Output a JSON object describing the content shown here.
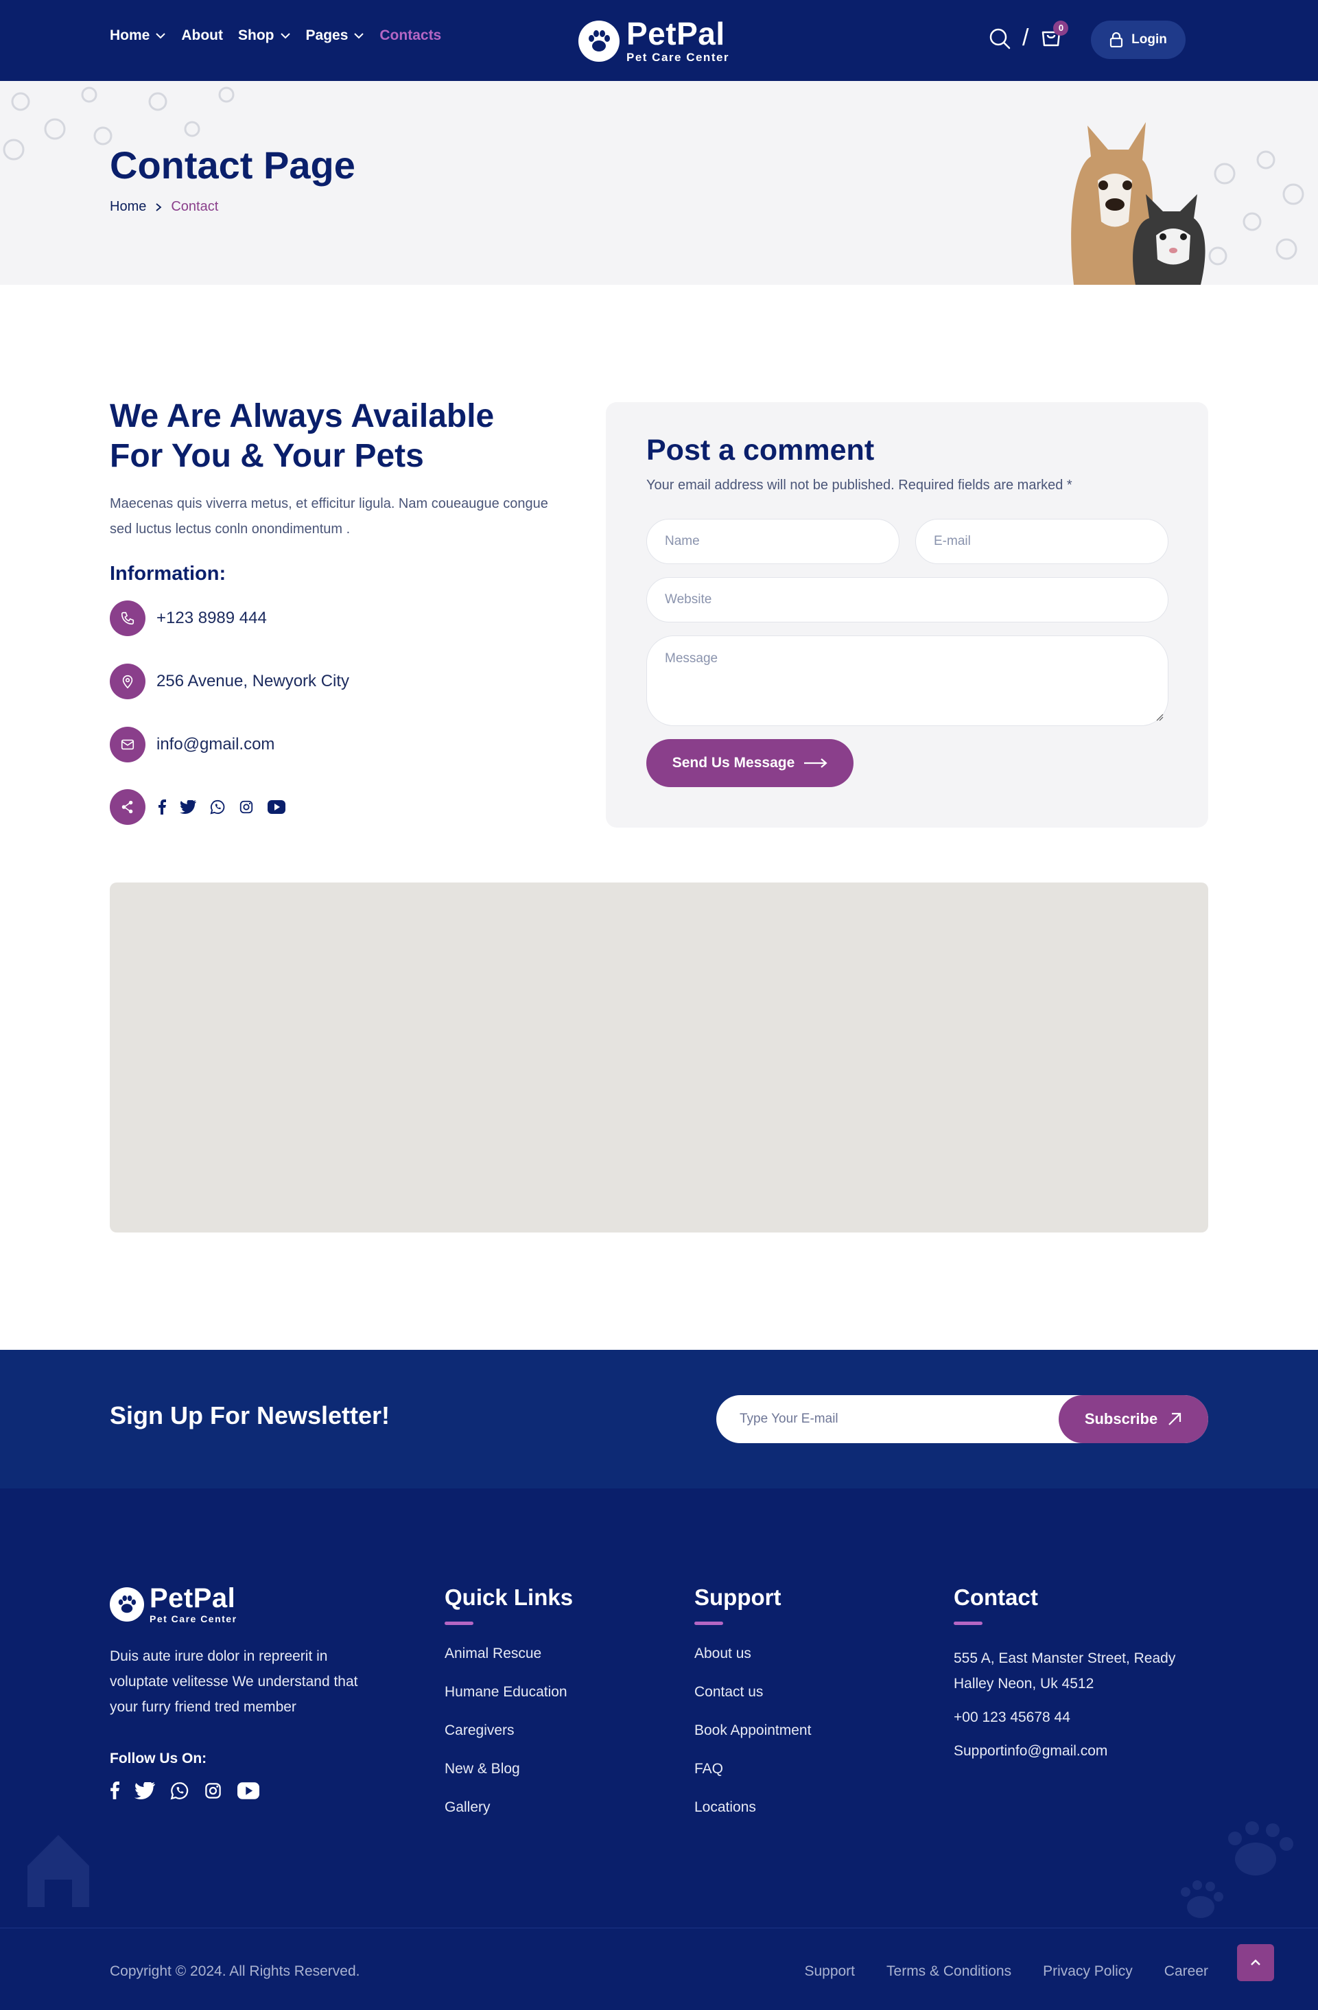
{
  "nav": {
    "items": [
      {
        "label": "Home",
        "has_dropdown": true,
        "active": false
      },
      {
        "label": "About",
        "has_dropdown": false,
        "active": false
      },
      {
        "label": "Shop",
        "has_dropdown": true,
        "active": false
      },
      {
        "label": "Pages",
        "has_dropdown": true,
        "active": false
      },
      {
        "label": "Contacts",
        "has_dropdown": false,
        "active": true
      }
    ],
    "cart_count": "0",
    "login_label": "Login"
  },
  "brand": {
    "name": "PetPal",
    "tagline": "Pet Care Center"
  },
  "banner": {
    "title": "Contact Page",
    "breadcrumb_home": "Home",
    "breadcrumb_current": "Contact"
  },
  "info": {
    "heading": "We Are Always Available For You & Your Pets",
    "description": "Maecenas quis viverra metus, et efficitur ligula. Nam coueaugue congue sed luctus lectus conln onondimentum .",
    "subheading": "Information:",
    "phone": "+123 8989 444",
    "address": "256 Avenue, Newyork City",
    "email": "info@gmail.com",
    "social_icons": [
      "facebook-icon",
      "twitter-icon",
      "whatsapp-icon",
      "instagram-icon",
      "youtube-icon"
    ]
  },
  "form": {
    "title": "Post a comment",
    "note": "Your email address will not be published. Required fields are marked *",
    "name_placeholder": "Name",
    "email_placeholder": "E-mail",
    "website_placeholder": "Website",
    "message_placeholder": "Message",
    "submit_label": "Send Us Message"
  },
  "newsletter": {
    "title": "Sign Up For Newsletter!",
    "input_placeholder": "Type Your E-mail",
    "button_label": "Subscribe"
  },
  "footer": {
    "description": "Duis aute irure dolor in repreerit in voluptate velitesse We understand that your furry friend tred member",
    "follow_label": "Follow Us On:",
    "quick_links": {
      "title": "Quick Links",
      "items": [
        "Animal Rescue",
        "Humane Education",
        "Caregivers",
        "New & Blog",
        "Gallery"
      ]
    },
    "support": {
      "title": "Support",
      "items": [
        "About us",
        "Contact us",
        "Book Appointment",
        "FAQ",
        "Locations"
      ]
    },
    "contact": {
      "title": "Contact",
      "address": "555 A, East Manster Street, Ready Halley Neon, Uk 4512",
      "phone": "+00 123 45678 44",
      "email": "Supportinfo@gmail.com"
    },
    "copyright": "Copyright © 2024. All Rights Reserved.",
    "bottom_links": [
      "Support",
      "Terms & Conditions",
      "Privacy Policy",
      "Career"
    ]
  },
  "colors": {
    "navy": "#0a1f6b",
    "purple": "#8a3f8b",
    "accent_pink": "#b566c4",
    "light_bg": "#f4f4f6",
    "map_bg": "#e5e3df"
  }
}
